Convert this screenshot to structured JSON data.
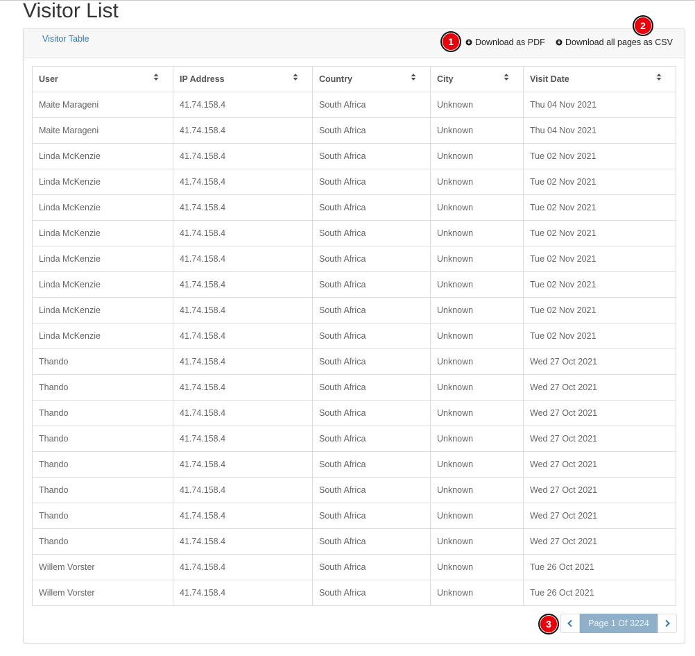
{
  "page": {
    "title": "Visitor List"
  },
  "panel": {
    "tab_label": "Visitor Table",
    "download_pdf_label": "Download as PDF",
    "download_csv_label": "Download all pages as CSV"
  },
  "table": {
    "headers": [
      "User",
      "IP Address",
      "Country",
      "City",
      "Visit Date"
    ],
    "rows": [
      [
        "Maite Marageni",
        "41.74.158.4",
        "South Africa",
        "Unknown",
        "Thu 04 Nov 2021"
      ],
      [
        "Maite Marageni",
        "41.74.158.4",
        "South Africa",
        "Unknown",
        "Thu 04 Nov 2021"
      ],
      [
        "Linda McKenzie",
        "41.74.158.4",
        "South Africa",
        "Unknown",
        "Tue 02 Nov 2021"
      ],
      [
        "Linda McKenzie",
        "41.74.158.4",
        "South Africa",
        "Unknown",
        "Tue 02 Nov 2021"
      ],
      [
        "Linda McKenzie",
        "41.74.158.4",
        "South Africa",
        "Unknown",
        "Tue 02 Nov 2021"
      ],
      [
        "Linda McKenzie",
        "41.74.158.4",
        "South Africa",
        "Unknown",
        "Tue 02 Nov 2021"
      ],
      [
        "Linda McKenzie",
        "41.74.158.4",
        "South Africa",
        "Unknown",
        "Tue 02 Nov 2021"
      ],
      [
        "Linda McKenzie",
        "41.74.158.4",
        "South Africa",
        "Unknown",
        "Tue 02 Nov 2021"
      ],
      [
        "Linda McKenzie",
        "41.74.158.4",
        "South Africa",
        "Unknown",
        "Tue 02 Nov 2021"
      ],
      [
        "Linda McKenzie",
        "41.74.158.4",
        "South Africa",
        "Unknown",
        "Tue 02 Nov 2021"
      ],
      [
        "Thando",
        "41.74.158.4",
        "South Africa",
        "Unknown",
        "Wed 27 Oct 2021"
      ],
      [
        "Thando",
        "41.74.158.4",
        "South Africa",
        "Unknown",
        "Wed 27 Oct 2021"
      ],
      [
        "Thando",
        "41.74.158.4",
        "South Africa",
        "Unknown",
        "Wed 27 Oct 2021"
      ],
      [
        "Thando",
        "41.74.158.4",
        "South Africa",
        "Unknown",
        "Wed 27 Oct 2021"
      ],
      [
        "Thando",
        "41.74.158.4",
        "South Africa",
        "Unknown",
        "Wed 27 Oct 2021"
      ],
      [
        "Thando",
        "41.74.158.4",
        "South Africa",
        "Unknown",
        "Wed 27 Oct 2021"
      ],
      [
        "Thando",
        "41.74.158.4",
        "South Africa",
        "Unknown",
        "Wed 27 Oct 2021"
      ],
      [
        "Thando",
        "41.74.158.4",
        "South Africa",
        "Unknown",
        "Wed 27 Oct 2021"
      ],
      [
        "Willem Vorster",
        "41.74.158.4",
        "South Africa",
        "Unknown",
        "Tue 26 Oct 2021"
      ],
      [
        "Willem Vorster",
        "41.74.158.4",
        "South Africa",
        "Unknown",
        "Tue 26 Oct 2021"
      ]
    ]
  },
  "pagination": {
    "page_label": "Page 1 Of 3224",
    "prev_icon": "chevron-left-icon",
    "next_icon": "chevron-right-icon"
  },
  "annotations": {
    "badge_1": "1",
    "badge_2": "2",
    "badge_3": "3"
  },
  "colors": {
    "badge_red": "#e8000b",
    "link_blue": "#337ab7",
    "page_label_bg": "#8fb0c8"
  }
}
